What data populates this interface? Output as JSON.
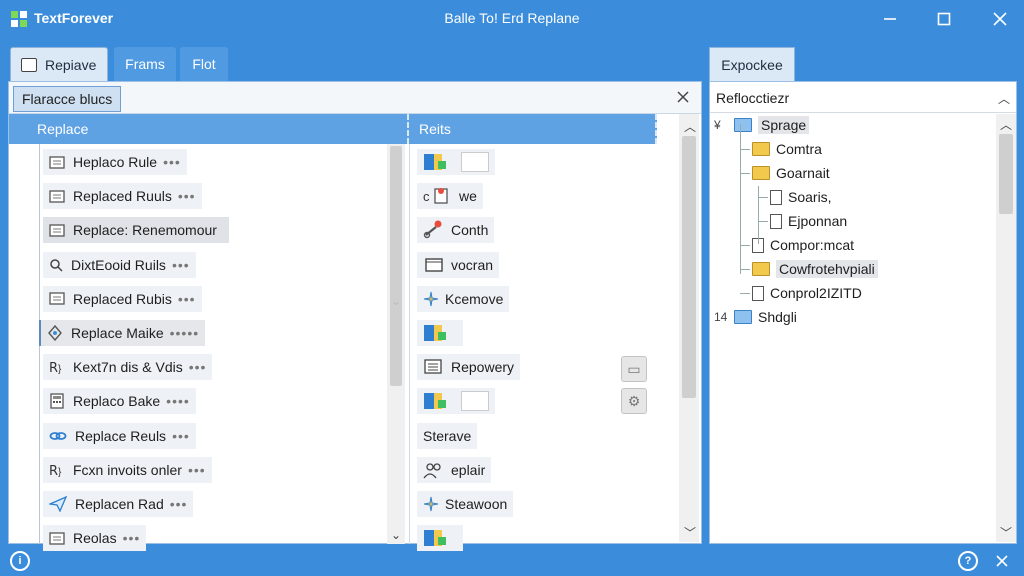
{
  "app": {
    "name": "TextForever",
    "window_title": "Balle To! Erd Replane"
  },
  "tabs": [
    {
      "label": "Repiave",
      "active": true
    },
    {
      "label": "Frams",
      "active": false
    },
    {
      "label": "Flot",
      "active": false
    }
  ],
  "toolbar": {
    "chip_label": "Flaracce blucs"
  },
  "columns": {
    "left": "Replace",
    "right": "Reits"
  },
  "rules": [
    {
      "label": "Heplaco Rule",
      "icon": "document-icon",
      "dots": "•••"
    },
    {
      "label": "Replaced Ruuls",
      "icon": "document-icon",
      "dots": "•••"
    },
    {
      "label": "Replace: Renemomour",
      "icon": "document-icon",
      "dots": ""
    },
    {
      "label": "DixtEooid Ruils",
      "icon": "search-icon",
      "dots": "•••"
    },
    {
      "label": "Replaced Rubis",
      "icon": "document-icon",
      "dots": "•••"
    },
    {
      "label": "Replace Maike",
      "icon": "settings-icon",
      "dots": "•••••"
    },
    {
      "label": "Kext7n dis & Vdis",
      "icon": "regex-icon",
      "dots": "•••"
    },
    {
      "label": "Replaco Bake",
      "icon": "calculator-icon",
      "dots": "••••"
    },
    {
      "label": "Replace Reuls",
      "icon": "link-icon",
      "dots": "•••"
    },
    {
      "label": "Fcxn invoits onler",
      "icon": "regex-icon",
      "dots": "•••"
    },
    {
      "label": "Replacen Rad",
      "icon": "send-icon",
      "dots": "•••"
    },
    {
      "label": "Reolas",
      "icon": "document-icon",
      "dots": "•••"
    }
  ],
  "results": [
    {
      "label": "",
      "icon": "folder-color-icon"
    },
    {
      "label": "we",
      "icon": "file-code-icon"
    },
    {
      "label": "Conth",
      "icon": "link-alert-icon"
    },
    {
      "label": "vocran",
      "icon": "window-icon"
    },
    {
      "label": "Kcemove",
      "icon": "spark-icon"
    },
    {
      "label": "",
      "icon": "folder-color-icon"
    },
    {
      "label": "Repowery",
      "icon": "stack-icon"
    },
    {
      "label": "",
      "icon": "folder-color-icon"
    },
    {
      "label": "Sterave",
      "icon": "none"
    },
    {
      "label": "eplair",
      "icon": "people-icon"
    },
    {
      "label": "Steawoon",
      "icon": "spark-icon"
    },
    {
      "label": "",
      "icon": "folder-color-icon"
    }
  ],
  "explorer": {
    "tab_label": "Expockee",
    "header": "Reflocctiezr",
    "tree": [
      {
        "label": "Sprage",
        "type": "folder-blue",
        "level": 0,
        "selected": true,
        "prefix": "¥"
      },
      {
        "label": "Comtra",
        "type": "folder",
        "level": 1
      },
      {
        "label": "Goarnait",
        "type": "folder",
        "level": 1
      },
      {
        "label": "Soaris,",
        "type": "file",
        "level": 2
      },
      {
        "label": "Ejponnan",
        "type": "file",
        "level": 2
      },
      {
        "label": "Compor:mcat",
        "type": "file",
        "level": 1
      },
      {
        "label": "Cowfrotehvpiali",
        "type": "folder",
        "level": 1,
        "selected": true
      },
      {
        "label": "Conprol2IZITD",
        "type": "file",
        "level": 1
      },
      {
        "label": "Shdgli",
        "type": "folder-blue",
        "level": 0,
        "prefix": "14"
      }
    ]
  },
  "colors": {
    "accent": "#3b8ddb",
    "header": "#5ea2e4",
    "folder": "#f2c94c"
  }
}
